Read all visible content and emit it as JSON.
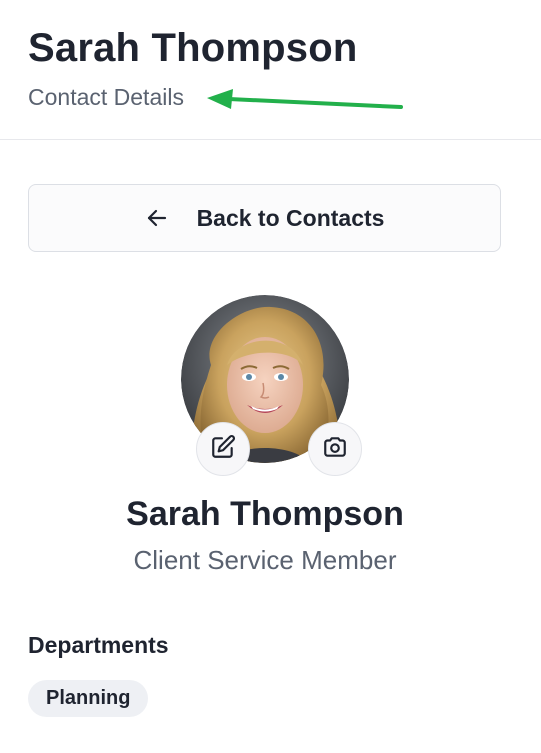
{
  "header": {
    "title": "Sarah Thompson",
    "subtitle": "Contact Details"
  },
  "back_button": {
    "label": "Back to Contacts",
    "icon": "arrow-left-icon"
  },
  "profile": {
    "name": "Sarah Thompson",
    "role": "Client Service Member",
    "avatar_actions": [
      "edit-icon",
      "camera-icon"
    ]
  },
  "departments": {
    "heading": "Departments",
    "tags": [
      "Planning"
    ]
  },
  "colors": {
    "annotation_arrow": "#22b04b",
    "text_primary": "#1f2430",
    "text_secondary": "#5a6270",
    "tag_background": "#eef0f4"
  }
}
